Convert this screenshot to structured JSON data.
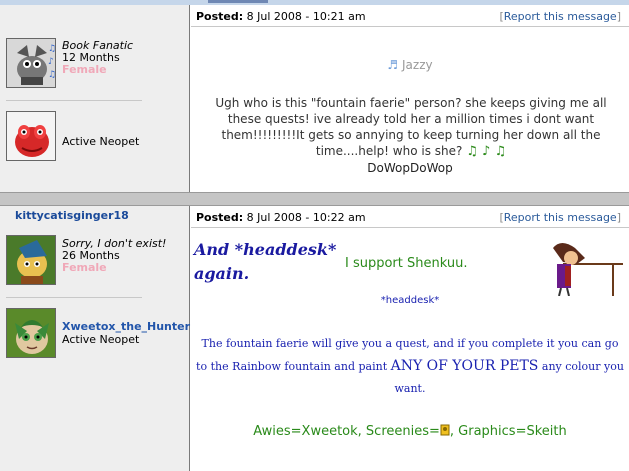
{
  "posts": [
    {
      "posted_label": "Posted:",
      "posted_date": "8 Jul 2008 - 10:21 am",
      "report_label": "Report this message",
      "user_title": "Book Fanatic",
      "user_age": "12 Months",
      "user_gender": "Female",
      "music_notes": "♫ ♪ ♫",
      "pet_status": "Active Neopet",
      "message": {
        "mood_note": "♬",
        "mood": "Jazzy",
        "body": "Ugh who is this \"fountain faerie\" person? she keeps giving me all these quests! ive already told her a million times i dont want them!!!!!!!!!It gets so annying to keep turning her down all the time....help! who is she?",
        "body_notes": "♫ ♪ ♫",
        "signature": "DoWopDoWop"
      }
    },
    {
      "username": "kittycatisginger18",
      "posted_label": "Posted:",
      "posted_date": "8 Jul 2008 - 10:22 am",
      "report_label": "Report this message",
      "user_title": "Sorry, I don't exist!",
      "user_age": "26 Months",
      "user_gender": "Female",
      "pet_name": "Xweetox_the_Hunter",
      "pet_status": "Active Neopet",
      "message": {
        "headline": "And *headdesk* again.",
        "support": "I support Shenkuu.",
        "headdesk": "*headdesk*",
        "body_a": "The fountain faerie will give you a quest, and if you complete it you can go to the Rainbow fountain and paint ",
        "body_caps": "ANY OF YOUR PETS",
        "body_b": " any colour you want.",
        "sig_a": "Awies=Xweetok, Screenies=",
        "sig_b": ", Graphics=Skeith"
      }
    }
  ],
  "colors": {
    "link": "#2a5a9a",
    "female": "#f0a8b8",
    "music": "#2b8a1a",
    "signature_green": "#2a8a1a",
    "body_blue": "#1a22b0"
  }
}
